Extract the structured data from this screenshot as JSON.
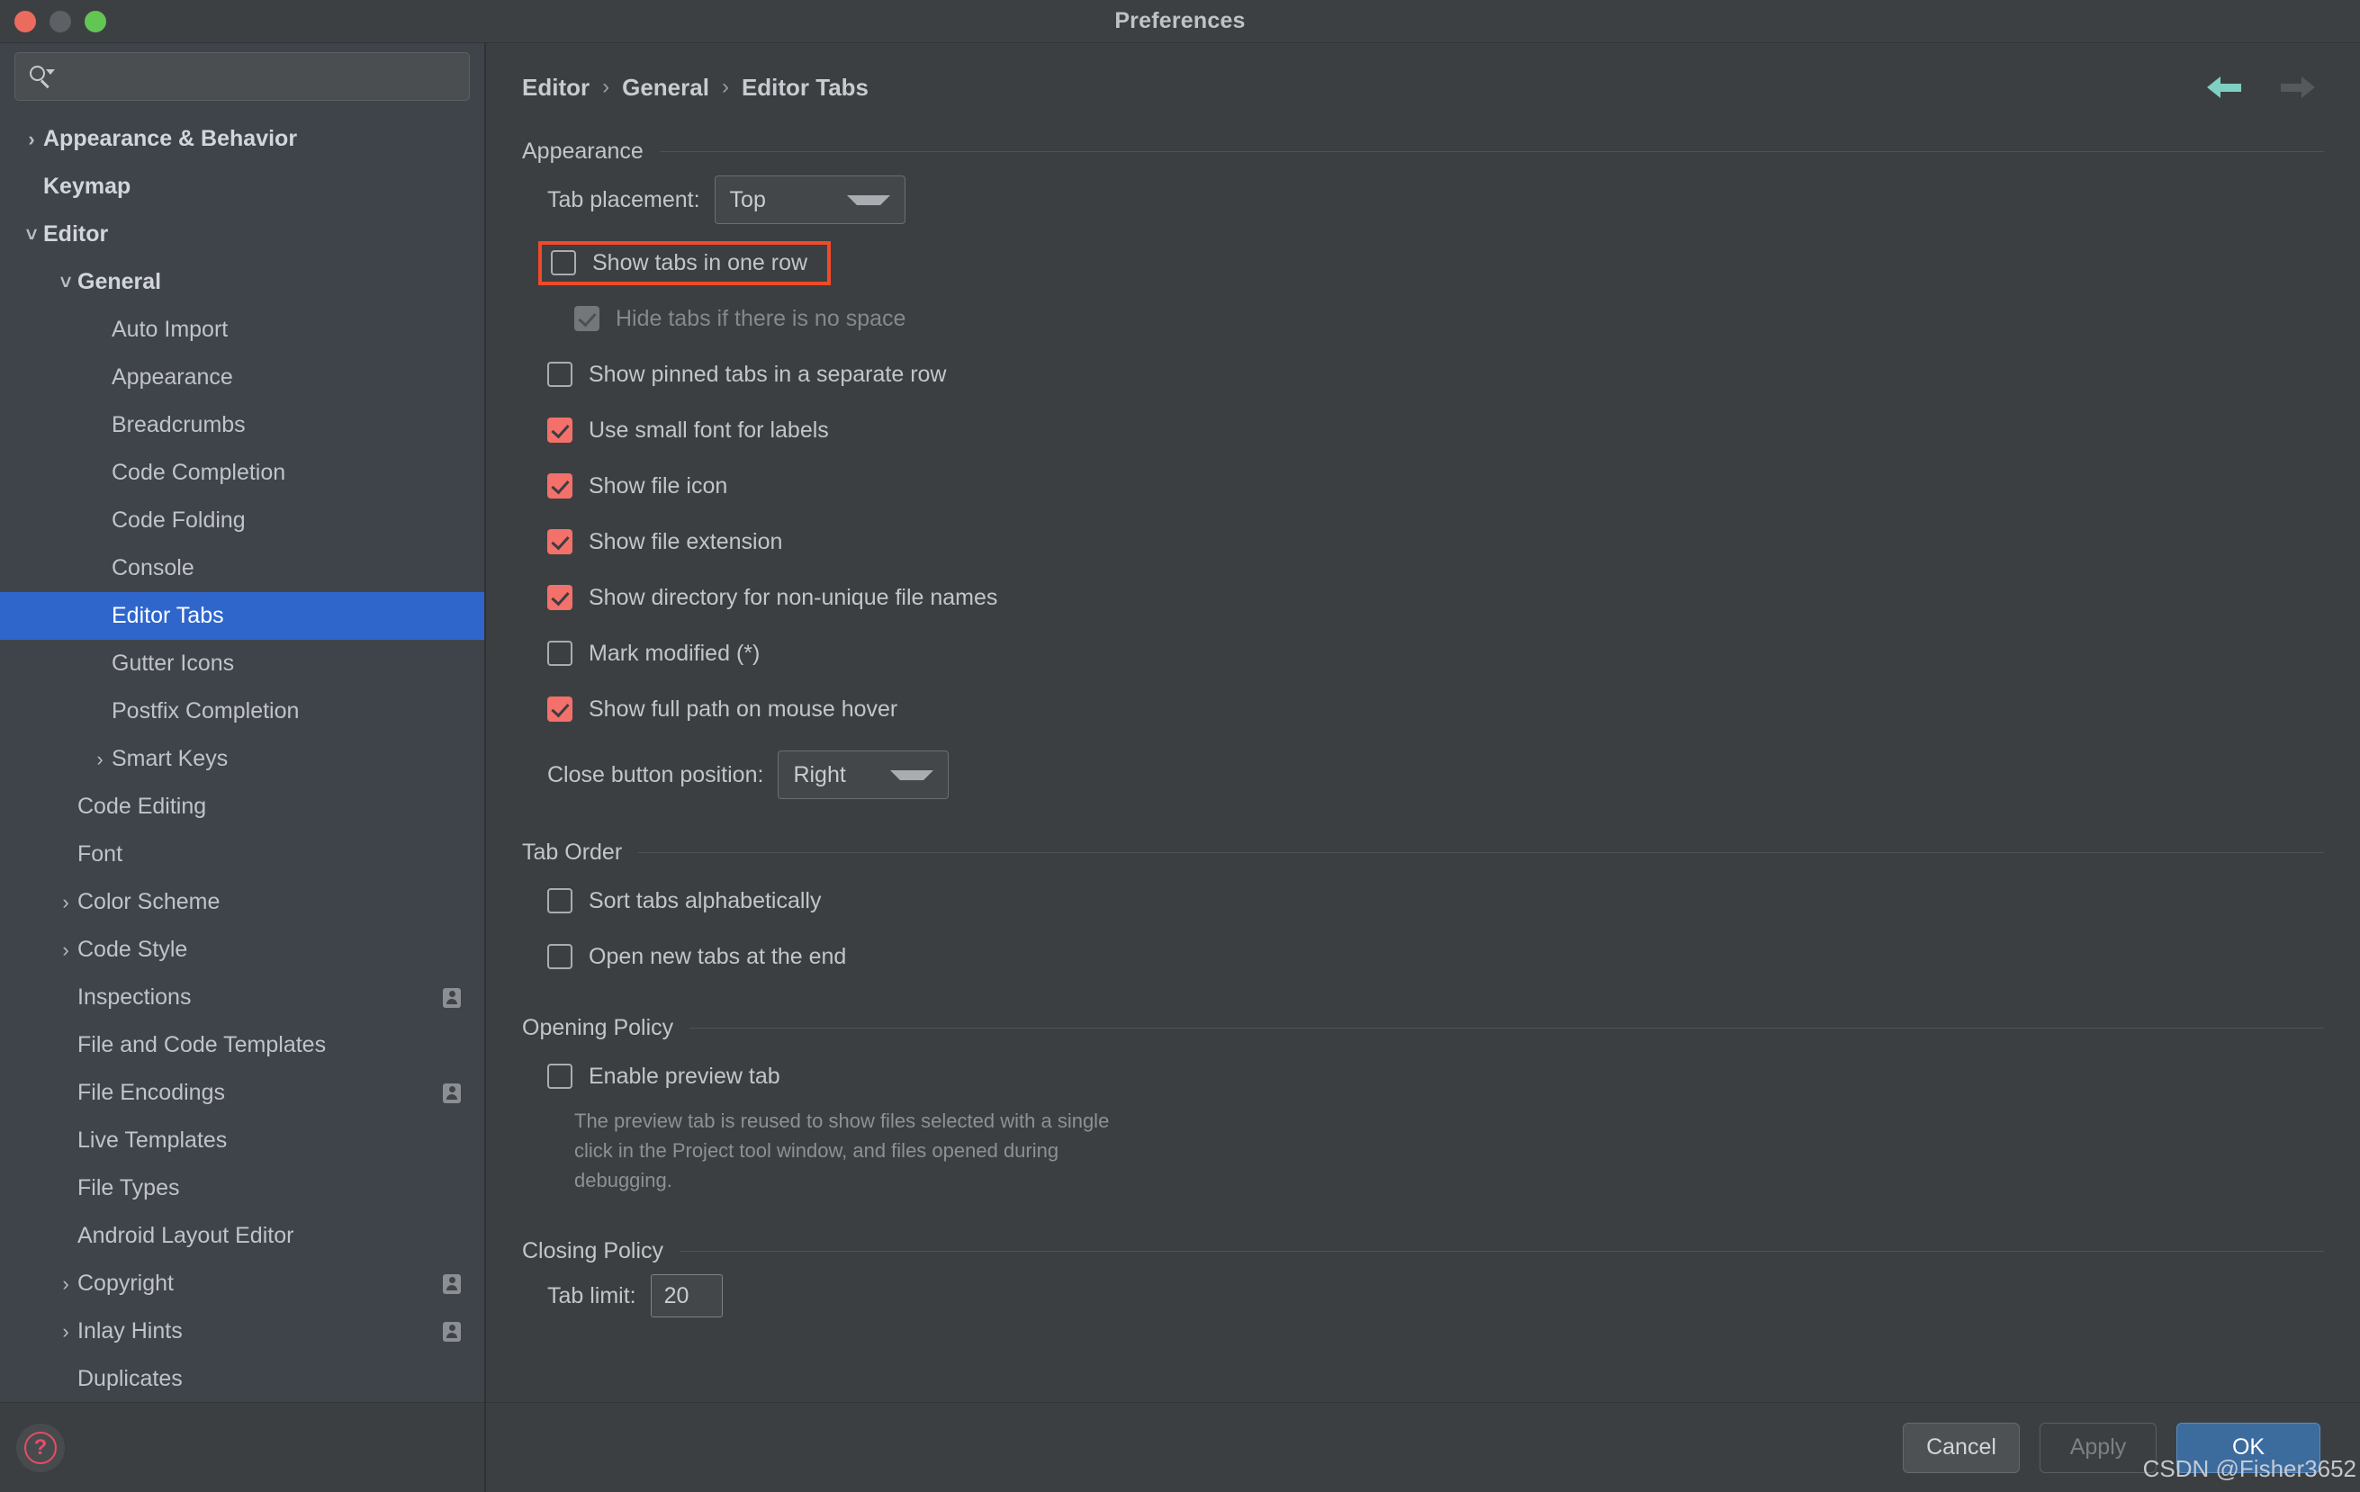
{
  "window": {
    "title": "Preferences",
    "traffic_lights": [
      "close-button",
      "minimize-button",
      "zoom-button"
    ]
  },
  "sidebar": {
    "search": {
      "value": "",
      "placeholder": ""
    },
    "items": [
      {
        "label": "Appearance & Behavior",
        "indent": 0,
        "arrow": "›",
        "bold": true,
        "selected": false,
        "badge": false
      },
      {
        "label": "Keymap",
        "indent": 0,
        "arrow": "",
        "bold": true,
        "selected": false,
        "badge": false
      },
      {
        "label": "Editor",
        "indent": 0,
        "arrow": "˅",
        "bold": true,
        "selected": false,
        "badge": false
      },
      {
        "label": "General",
        "indent": 1,
        "arrow": "˅",
        "bold": true,
        "selected": false,
        "badge": false
      },
      {
        "label": "Auto Import",
        "indent": 2,
        "arrow": "",
        "bold": false,
        "selected": false,
        "badge": false
      },
      {
        "label": "Appearance",
        "indent": 2,
        "arrow": "",
        "bold": false,
        "selected": false,
        "badge": false
      },
      {
        "label": "Breadcrumbs",
        "indent": 2,
        "arrow": "",
        "bold": false,
        "selected": false,
        "badge": false
      },
      {
        "label": "Code Completion",
        "indent": 2,
        "arrow": "",
        "bold": false,
        "selected": false,
        "badge": false
      },
      {
        "label": "Code Folding",
        "indent": 2,
        "arrow": "",
        "bold": false,
        "selected": false,
        "badge": false
      },
      {
        "label": "Console",
        "indent": 2,
        "arrow": "",
        "bold": false,
        "selected": false,
        "badge": false
      },
      {
        "label": "Editor Tabs",
        "indent": 2,
        "arrow": "",
        "bold": false,
        "selected": true,
        "badge": false
      },
      {
        "label": "Gutter Icons",
        "indent": 2,
        "arrow": "",
        "bold": false,
        "selected": false,
        "badge": false
      },
      {
        "label": "Postfix Completion",
        "indent": 2,
        "arrow": "",
        "bold": false,
        "selected": false,
        "badge": false
      },
      {
        "label": "Smart Keys",
        "indent": 2,
        "arrow": "›",
        "bold": false,
        "selected": false,
        "badge": false
      },
      {
        "label": "Code Editing",
        "indent": 1,
        "arrow": "",
        "bold": false,
        "selected": false,
        "badge": false
      },
      {
        "label": "Font",
        "indent": 1,
        "arrow": "",
        "bold": false,
        "selected": false,
        "badge": false
      },
      {
        "label": "Color Scheme",
        "indent": 1,
        "arrow": "›",
        "bold": false,
        "selected": false,
        "badge": false
      },
      {
        "label": "Code Style",
        "indent": 1,
        "arrow": "›",
        "bold": false,
        "selected": false,
        "badge": false
      },
      {
        "label": "Inspections",
        "indent": 1,
        "arrow": "",
        "bold": false,
        "selected": false,
        "badge": true
      },
      {
        "label": "File and Code Templates",
        "indent": 1,
        "arrow": "",
        "bold": false,
        "selected": false,
        "badge": false
      },
      {
        "label": "File Encodings",
        "indent": 1,
        "arrow": "",
        "bold": false,
        "selected": false,
        "badge": true
      },
      {
        "label": "Live Templates",
        "indent": 1,
        "arrow": "",
        "bold": false,
        "selected": false,
        "badge": false
      },
      {
        "label": "File Types",
        "indent": 1,
        "arrow": "",
        "bold": false,
        "selected": false,
        "badge": false
      },
      {
        "label": "Android Layout Editor",
        "indent": 1,
        "arrow": "",
        "bold": false,
        "selected": false,
        "badge": false
      },
      {
        "label": "Copyright",
        "indent": 1,
        "arrow": "›",
        "bold": false,
        "selected": false,
        "badge": true
      },
      {
        "label": "Inlay Hints",
        "indent": 1,
        "arrow": "›",
        "bold": false,
        "selected": false,
        "badge": true
      },
      {
        "label": "Duplicates",
        "indent": 1,
        "arrow": "",
        "bold": false,
        "selected": false,
        "badge": false
      }
    ],
    "help_glyph": "?"
  },
  "breadcrumb": {
    "parts": [
      "Editor",
      "General",
      "Editor Tabs"
    ],
    "separator": "›"
  },
  "main": {
    "sections": {
      "appearance": {
        "title": "Appearance",
        "tab_placement_label": "Tab placement:",
        "tab_placement_value": "Top",
        "close_button_label": "Close button position:",
        "close_button_value": "Right",
        "checkboxes": [
          {
            "label": "Show tabs in one row",
            "state": "off",
            "highlighted": true,
            "indent": 0
          },
          {
            "label": "Hide tabs if there is no space",
            "state": "disabled-on",
            "highlighted": false,
            "indent": 1
          },
          {
            "label": "Show pinned tabs in a separate row",
            "state": "off",
            "highlighted": false,
            "indent": 0
          },
          {
            "label": "Use small font for labels",
            "state": "on",
            "highlighted": false,
            "indent": 0
          },
          {
            "label": "Show file icon",
            "state": "on",
            "highlighted": false,
            "indent": 0
          },
          {
            "label": "Show file extension",
            "state": "on",
            "highlighted": false,
            "indent": 0
          },
          {
            "label": "Show directory for non-unique file names",
            "state": "on",
            "highlighted": false,
            "indent": 0
          },
          {
            "label": "Mark modified (*)",
            "state": "off",
            "highlighted": false,
            "indent": 0
          },
          {
            "label": "Show full path on mouse hover",
            "state": "on",
            "highlighted": false,
            "indent": 0
          }
        ]
      },
      "tab_order": {
        "title": "Tab Order",
        "checkboxes": [
          {
            "label": "Sort tabs alphabetically",
            "state": "off"
          },
          {
            "label": "Open new tabs at the end",
            "state": "off"
          }
        ]
      },
      "opening_policy": {
        "title": "Opening Policy",
        "checkboxes": [
          {
            "label": "Enable preview tab",
            "state": "off"
          }
        ],
        "hint": "The preview tab is reused to show files selected with a single click in the Project tool window, and files opened during debugging."
      },
      "closing_policy": {
        "title": "Closing Policy",
        "tab_limit_label": "Tab limit:",
        "tab_limit_value": "20"
      }
    }
  },
  "footer": {
    "cancel_label": "Cancel",
    "apply_label": "Apply",
    "ok_label": "OK",
    "watermark": "CSDN @Fisher3652"
  },
  "colors": {
    "selection_blue": "#2e66cc",
    "checkbox_checked": "#f4706a",
    "highlight_red": "#f04a29",
    "ok_button": "#3c6b9e",
    "back_arrow": "#7ed0c3",
    "help_accent": "#ec4a68"
  }
}
